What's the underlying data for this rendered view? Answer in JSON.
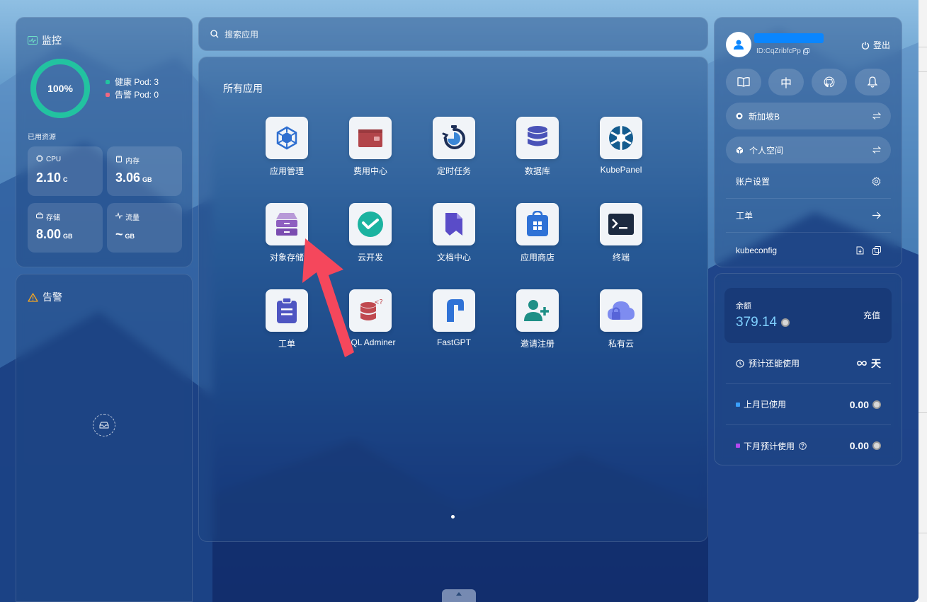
{
  "monitor": {
    "title": "监控",
    "health_percent_label": "100%",
    "health_fraction": 1.0,
    "legend": [
      {
        "label": "健康 Pod: 3",
        "color": "#22c3a0"
      },
      {
        "label": "告警 Pod: 0",
        "color": "#f06882"
      }
    ],
    "resources_label": "已用资源",
    "resources": [
      {
        "label": "CPU",
        "value": "2.10",
        "unit": "C",
        "icon": "cpu-icon"
      },
      {
        "label": "内存",
        "value": "3.06",
        "unit": "GB",
        "icon": "memory-icon"
      },
      {
        "label": "存储",
        "value": "8.00",
        "unit": "GB",
        "icon": "storage-icon"
      },
      {
        "label": "流量",
        "value": "~",
        "unit": "GB",
        "icon": "traffic-icon"
      }
    ]
  },
  "alerts": {
    "title": "告警"
  },
  "search": {
    "placeholder": "搜索应用"
  },
  "apps": {
    "title": "所有应用",
    "items": [
      {
        "name": "应用管理",
        "icon": "app-manage-icon"
      },
      {
        "name": "费用中心",
        "icon": "wallet-icon"
      },
      {
        "name": "定时任务",
        "icon": "timer-icon"
      },
      {
        "name": "数据库",
        "icon": "database-icon"
      },
      {
        "name": "KubePanel",
        "icon": "kubepanel-icon"
      },
      {
        "name": "对象存储",
        "icon": "object-storage-icon"
      },
      {
        "name": "云开发",
        "icon": "cloud-dev-icon"
      },
      {
        "name": "文档中心",
        "icon": "docs-icon"
      },
      {
        "name": "应用商店",
        "icon": "app-store-icon"
      },
      {
        "name": "终端",
        "icon": "terminal-icon"
      },
      {
        "name": "工单",
        "icon": "ticket-icon"
      },
      {
        "name": "SQL Adminer",
        "icon": "sql-adminer-icon"
      },
      {
        "name": "FastGPT",
        "icon": "fastgpt-icon"
      },
      {
        "name": "邀请注册",
        "icon": "invite-icon"
      },
      {
        "name": "私有云",
        "icon": "private-cloud-icon"
      }
    ]
  },
  "user": {
    "id_label": "ID:CqZribfcPp",
    "logout_label": "登出",
    "quick_buttons": [
      {
        "icon": "book-icon",
        "text": ""
      },
      {
        "icon": "language-icon",
        "text": "中"
      },
      {
        "icon": "github-icon",
        "text": ""
      },
      {
        "icon": "bell-icon",
        "text": ""
      }
    ],
    "region": "新加坡B",
    "workspace": "个人空间",
    "menu": [
      {
        "label": "账户设置",
        "icon": "settings-icon"
      },
      {
        "label": "工单",
        "icon": "arrow-right-icon"
      },
      {
        "label": "kubeconfig",
        "icon": "download-icon"
      }
    ]
  },
  "balance": {
    "label": "余额",
    "value": "379.14",
    "recharge_label": "充值",
    "rows": [
      {
        "label": "预计还能使用",
        "value": "天",
        "icon": "clock-icon"
      },
      {
        "label": "上月已使用",
        "value": "0.00",
        "color": "#3aa0ff"
      },
      {
        "label": "下月预计使用",
        "value": "0.00",
        "color": "#b548f0"
      }
    ]
  },
  "colors": {
    "accent_teal": "#22c3a0",
    "alert_pink": "#f06882",
    "annotation_arrow": "#f5475c",
    "username_bar": "#0a86ff"
  }
}
